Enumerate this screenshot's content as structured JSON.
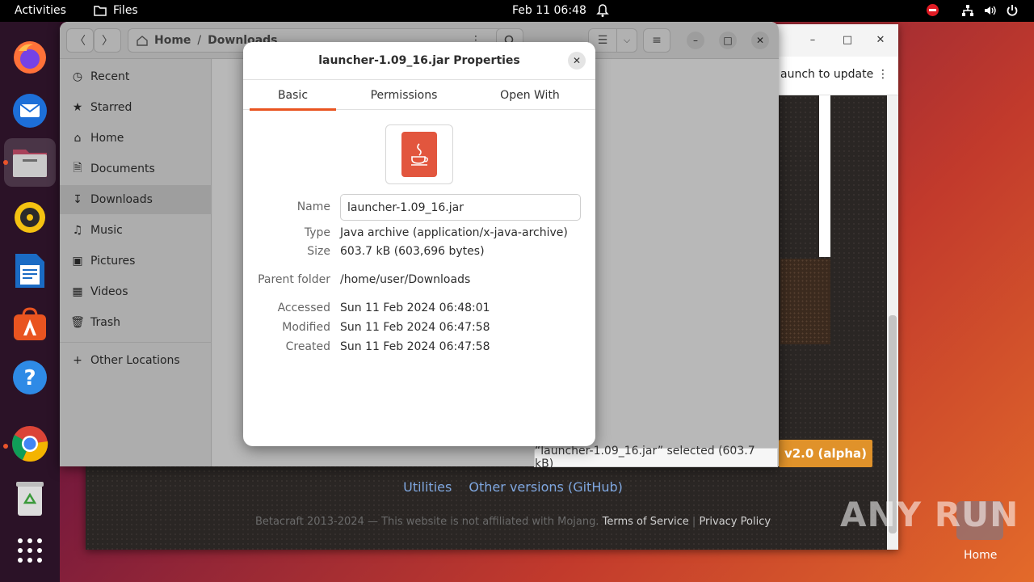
{
  "topbar": {
    "activities": "Activities",
    "app_name": "Files",
    "datetime": "Feb 11  06:48"
  },
  "dock": {
    "items": [
      "firefox-icon",
      "thunderbird-icon",
      "files-icon",
      "rhythmbox-icon",
      "libreoffice-writer-icon",
      "app-center-icon",
      "help-icon",
      "chrome-icon",
      "trash-icon",
      "show-apps-icon"
    ]
  },
  "browser": {
    "update_text": "aunch to update",
    "alpha_button": "v2.0 (alpha)",
    "links": [
      "Utilities",
      "Other versions (GitHub)"
    ],
    "footer": {
      "copyright": "Betacraft 2013-2024 — This website is not affiliated with Mojang.",
      "terms": "Terms of Service",
      "separator": "|",
      "privacy": "Privacy Policy"
    }
  },
  "files": {
    "path": {
      "home": "Home",
      "separator": "/",
      "current": "Downloads"
    },
    "sidebar": [
      {
        "label": "Recent",
        "icon": "clock-icon",
        "selected": false
      },
      {
        "label": "Starred",
        "icon": "star-icon",
        "selected": false
      },
      {
        "label": "Home",
        "icon": "home-icon",
        "selected": false
      },
      {
        "label": "Documents",
        "icon": "document-icon",
        "selected": false
      },
      {
        "label": "Downloads",
        "icon": "download-icon",
        "selected": true
      },
      {
        "label": "Music",
        "icon": "music-icon",
        "selected": false
      },
      {
        "label": "Pictures",
        "icon": "picture-icon",
        "selected": false
      },
      {
        "label": "Videos",
        "icon": "video-icon",
        "selected": false
      },
      {
        "label": "Trash",
        "icon": "trash-icon",
        "selected": false
      }
    ],
    "other_locations": "Other Locations",
    "status": "“launcher-1.09_16.jar” selected  (603.7 kB)"
  },
  "dialog": {
    "title": "launcher-1.09_16.jar Properties",
    "tabs": [
      "Basic",
      "Permissions",
      "Open With"
    ],
    "active_tab": "Basic",
    "labels": {
      "name": "Name",
      "type": "Type",
      "size": "Size",
      "parent": "Parent folder",
      "accessed": "Accessed",
      "modified": "Modified",
      "created": "Created"
    },
    "values": {
      "name": "launcher-1.09_16.jar",
      "type": "Java archive (application/x-java-archive)",
      "size": "603.7 kB (603,696 bytes)",
      "parent": "/home/user/Downloads",
      "accessed": "Sun 11 Feb 2024 06:48:01",
      "modified": "Sun 11 Feb 2024 06:47:58",
      "created": "Sun 11 Feb 2024 06:47:58"
    }
  },
  "desktop": {
    "home_label": "Home",
    "watermark": "ANY RUN"
  },
  "colors": {
    "accent": "#e95420",
    "jar_icon": "#e2563e",
    "alpha_button": "#e0922a",
    "link": "#7fa7e0"
  }
}
